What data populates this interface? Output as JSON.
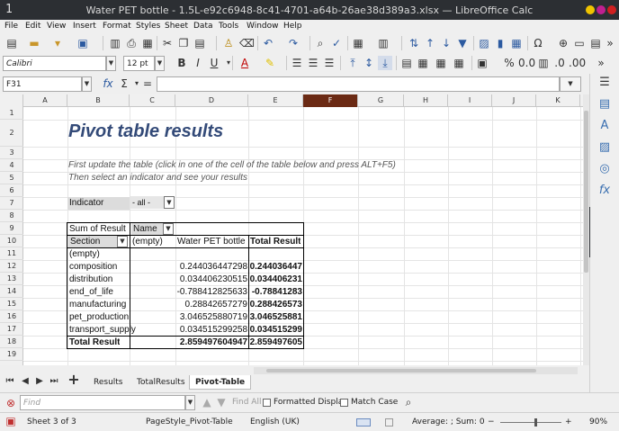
{
  "window": {
    "title": "Water PET bottle - 1.5L-e92c6948-8c41-4701-a64b-26ae38d389a3.xlsx — LibreOffice Calc",
    "app_icon": "1"
  },
  "menu": [
    "File",
    "Edit",
    "View",
    "Insert",
    "Format",
    "Styles",
    "Sheet",
    "Data",
    "Tools",
    "Window",
    "Help"
  ],
  "font": {
    "name": "Calibri",
    "size": "12 pt"
  },
  "formula": {
    "name_box": "F31",
    "content": ""
  },
  "columns": [
    "A",
    "B",
    "C",
    "D",
    "E",
    "F",
    "G",
    "H",
    "I",
    "J",
    "K"
  ],
  "selected_column": "F",
  "rows": [
    "1",
    "2",
    "3",
    "4",
    "5",
    "6",
    "7",
    "8",
    "9",
    "10",
    "11",
    "12",
    "13",
    "14",
    "15",
    "16",
    "17",
    "18",
    "19"
  ],
  "sheet": {
    "title": "Pivot table results",
    "instruction1": "First update the table (click in one of the cell of the table below and press ALT+F5)",
    "instruction2": "Then select an indicator and see your results",
    "indicator_label": "Indicator",
    "indicator_value": "- all -",
    "pivot": {
      "sum_label": "Sum of Result",
      "name_label": "Name",
      "section_label": "Section",
      "empty_col": "(empty)",
      "water_col": "Water PET bottle",
      "total_col": "Total Result",
      "rows": [
        {
          "section": "(empty)",
          "water": "",
          "total": ""
        },
        {
          "section": "composition",
          "water": "0.244036447298",
          "total": "0.244036447"
        },
        {
          "section": "distribution",
          "water": "0.034406230515",
          "total": "0.034406231"
        },
        {
          "section": "end_of_life",
          "water": "-0.788412825633",
          "total": "-0.78841283"
        },
        {
          "section": "manufacturing",
          "water": "0.28842657279",
          "total": "0.288426573"
        },
        {
          "section": "pet_production",
          "water": "3.046525880719",
          "total": "3.046525881"
        },
        {
          "section": "transport_supply",
          "water": "0.034515299258",
          "total": "0.034515299"
        }
      ],
      "total_row": {
        "section": "Total Result",
        "water": "2.859497604947",
        "total": "2.859497605"
      }
    }
  },
  "tabs": [
    "Results",
    "TotalResults",
    "Pivot-Table"
  ],
  "active_tab": "Pivot-Table",
  "find": {
    "placeholder": "Find",
    "find_all": "Find All",
    "formatted_display": "Formatted Display",
    "match_case": "Match Case"
  },
  "status": {
    "sheet": "Sheet 3 of 3",
    "page_style": "PageStyle_Pivot-Table",
    "language": "English (UK)",
    "summary": "Average: ; Sum: 0",
    "zoom": "90%"
  }
}
